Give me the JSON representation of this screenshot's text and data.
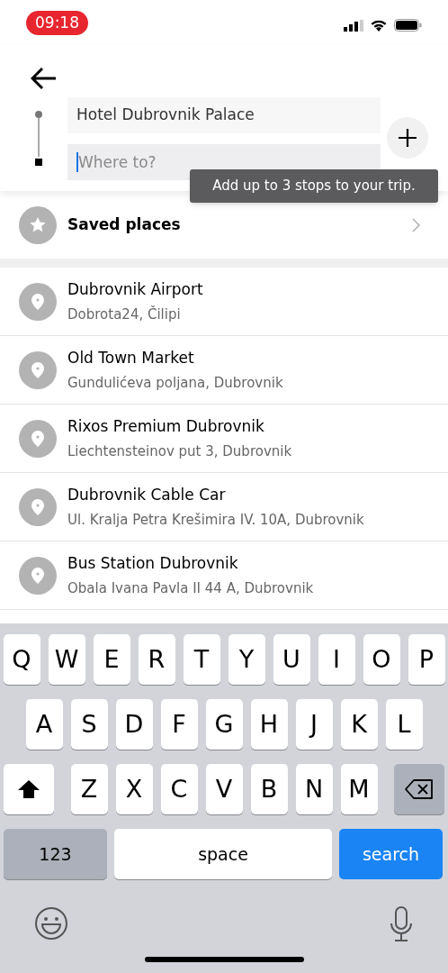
{
  "status_bar": {
    "time": "09:18"
  },
  "route": {
    "pickup": "Hotel Dubrovnik Palace",
    "destination_placeholder": "Where to?"
  },
  "tooltip": "Add up to 3 stops to your trip.",
  "saved_places": "Saved places",
  "places": [
    {
      "name": "Dubrovnik Airport",
      "address": "Dobrota24, Čilipi"
    },
    {
      "name": "Old Town Market",
      "address": "Gundulićeva poljana, Dubrovnik"
    },
    {
      "name": "Rixos Premium Dubrovnik",
      "address": "Liechtensteinov put 3, Dubrovnik"
    },
    {
      "name": "Dubrovnik Cable Car",
      "address": "Ul. Kralja Petra Krešimira IV. 10A, Dubrovnik"
    },
    {
      "name": "Bus Station Dubrovnik",
      "address": "Obala Ivana Pavla II 44 A, Dubrovnik"
    }
  ],
  "keyboard": {
    "rows": [
      [
        "Q",
        "W",
        "E",
        "R",
        "T",
        "Y",
        "U",
        "I",
        "O",
        "P"
      ],
      [
        "A",
        "S",
        "D",
        "F",
        "G",
        "H",
        "J",
        "K",
        "L"
      ],
      [
        "Z",
        "X",
        "C",
        "V",
        "B",
        "N",
        "M"
      ]
    ],
    "numbers_key": "123",
    "space_key": "space",
    "action_key": "search"
  }
}
